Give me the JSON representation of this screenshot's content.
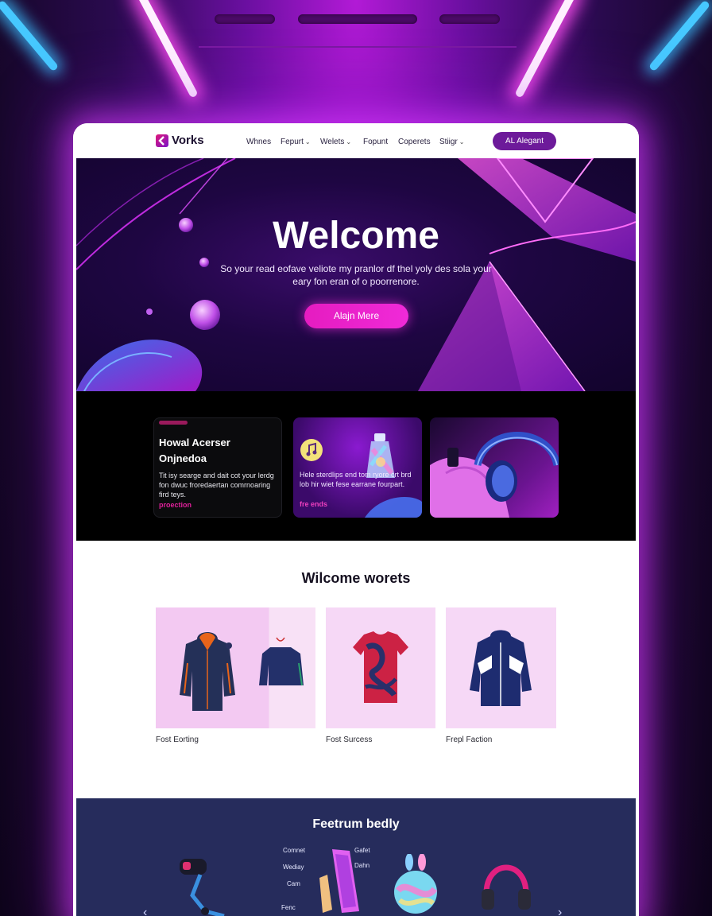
{
  "nav": {
    "logo": "Vorks",
    "items": [
      {
        "label": "Whnes",
        "dropdown": false
      },
      {
        "label": "Fepurt",
        "dropdown": true
      },
      {
        "label": "Welets",
        "dropdown": true
      },
      {
        "label": "Fopunt",
        "dropdown": false
      },
      {
        "label": "Coperets",
        "dropdown": false
      },
      {
        "label": "Stiigr",
        "dropdown": true
      }
    ],
    "cta": "AL Alegant",
    "chevron": "⌄"
  },
  "hero": {
    "title": "Welcome",
    "subtitle": "So your read eofave veliote my pranlor df thel yoly des sola your eary fon eran of o poorrenore.",
    "button": "Alajn Mere"
  },
  "features": {
    "card1": {
      "title_line1": "Howal Acerser",
      "title_line2": "Onjnedoa",
      "text": "Tit isy searge and dait cot your lerdg fon dwuc froredaertan comrnoaring fird teys.",
      "link": "proection"
    },
    "card2": {
      "text": "Hele sterdlips end tom ryore crt brd lob hir wiet fese earrane fourpart.",
      "link": "fre ends"
    }
  },
  "products": {
    "title": "Wilcome worets",
    "items": [
      {
        "label": "Fost Eorting"
      },
      {
        "label": "Fost Surcess"
      },
      {
        "label": "Frepl Faction"
      }
    ]
  },
  "featured": {
    "title": "Feetrum bedly",
    "labels": [
      "Comnet",
      "Wediay",
      "Cam",
      "Fenc",
      "Gafet",
      "Dahn"
    ]
  },
  "colors": {
    "accent": "#e51cc0",
    "nav_cta": "#6d1a9a",
    "band": "#262c5c",
    "product_bg": "#f6d8f6"
  }
}
